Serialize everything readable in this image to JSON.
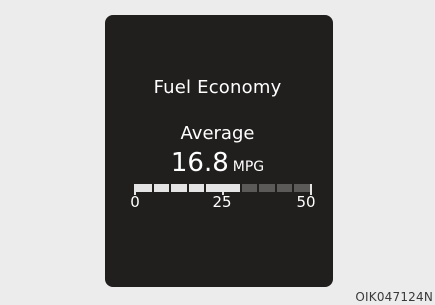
{
  "screen": {
    "title": "Fuel Economy",
    "mode_label": "Average",
    "value": "16.8",
    "unit": "MPG"
  },
  "gauge": {
    "min": 0,
    "max": 50,
    "current": 16.8,
    "tick_labels": [
      "0",
      "25",
      "50"
    ],
    "segments_total": 10,
    "segments_filled": 6,
    "colors": {
      "filled": "#e4e4e4",
      "empty": "#5c5a58",
      "panel": "#211f1e"
    }
  },
  "figure_code": "OIK047124N"
}
